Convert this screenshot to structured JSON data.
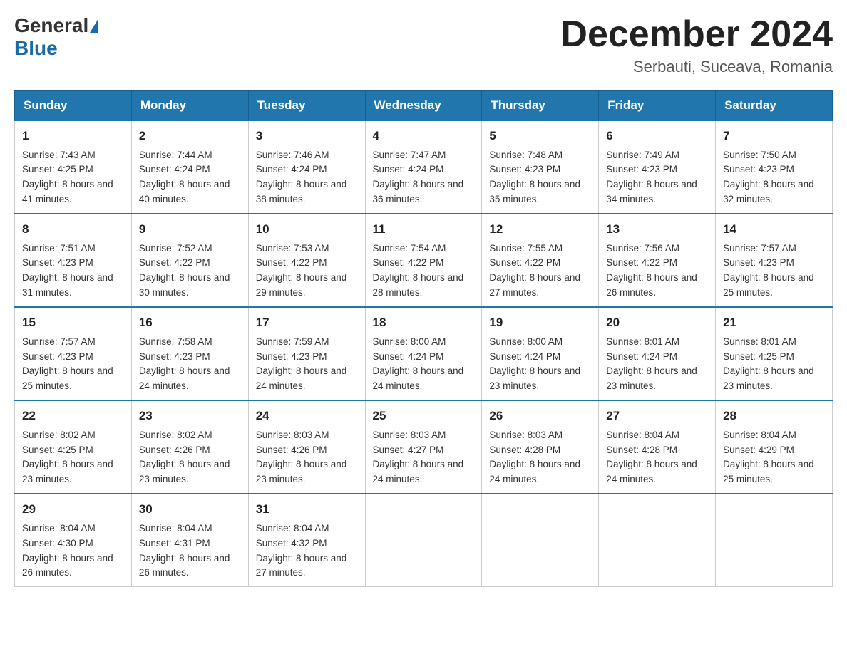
{
  "header": {
    "logo_general": "General",
    "logo_blue": "Blue",
    "month_title": "December 2024",
    "location": "Serbauti, Suceava, Romania"
  },
  "weekdays": [
    "Sunday",
    "Monday",
    "Tuesday",
    "Wednesday",
    "Thursday",
    "Friday",
    "Saturday"
  ],
  "weeks": [
    [
      {
        "day": "1",
        "sunrise": "7:43 AM",
        "sunset": "4:25 PM",
        "daylight": "8 hours and 41 minutes."
      },
      {
        "day": "2",
        "sunrise": "7:44 AM",
        "sunset": "4:24 PM",
        "daylight": "8 hours and 40 minutes."
      },
      {
        "day": "3",
        "sunrise": "7:46 AM",
        "sunset": "4:24 PM",
        "daylight": "8 hours and 38 minutes."
      },
      {
        "day": "4",
        "sunrise": "7:47 AM",
        "sunset": "4:24 PM",
        "daylight": "8 hours and 36 minutes."
      },
      {
        "day": "5",
        "sunrise": "7:48 AM",
        "sunset": "4:23 PM",
        "daylight": "8 hours and 35 minutes."
      },
      {
        "day": "6",
        "sunrise": "7:49 AM",
        "sunset": "4:23 PM",
        "daylight": "8 hours and 34 minutes."
      },
      {
        "day": "7",
        "sunrise": "7:50 AM",
        "sunset": "4:23 PM",
        "daylight": "8 hours and 32 minutes."
      }
    ],
    [
      {
        "day": "8",
        "sunrise": "7:51 AM",
        "sunset": "4:23 PM",
        "daylight": "8 hours and 31 minutes."
      },
      {
        "day": "9",
        "sunrise": "7:52 AM",
        "sunset": "4:22 PM",
        "daylight": "8 hours and 30 minutes."
      },
      {
        "day": "10",
        "sunrise": "7:53 AM",
        "sunset": "4:22 PM",
        "daylight": "8 hours and 29 minutes."
      },
      {
        "day": "11",
        "sunrise": "7:54 AM",
        "sunset": "4:22 PM",
        "daylight": "8 hours and 28 minutes."
      },
      {
        "day": "12",
        "sunrise": "7:55 AM",
        "sunset": "4:22 PM",
        "daylight": "8 hours and 27 minutes."
      },
      {
        "day": "13",
        "sunrise": "7:56 AM",
        "sunset": "4:22 PM",
        "daylight": "8 hours and 26 minutes."
      },
      {
        "day": "14",
        "sunrise": "7:57 AM",
        "sunset": "4:23 PM",
        "daylight": "8 hours and 25 minutes."
      }
    ],
    [
      {
        "day": "15",
        "sunrise": "7:57 AM",
        "sunset": "4:23 PM",
        "daylight": "8 hours and 25 minutes."
      },
      {
        "day": "16",
        "sunrise": "7:58 AM",
        "sunset": "4:23 PM",
        "daylight": "8 hours and 24 minutes."
      },
      {
        "day": "17",
        "sunrise": "7:59 AM",
        "sunset": "4:23 PM",
        "daylight": "8 hours and 24 minutes."
      },
      {
        "day": "18",
        "sunrise": "8:00 AM",
        "sunset": "4:24 PM",
        "daylight": "8 hours and 24 minutes."
      },
      {
        "day": "19",
        "sunrise": "8:00 AM",
        "sunset": "4:24 PM",
        "daylight": "8 hours and 23 minutes."
      },
      {
        "day": "20",
        "sunrise": "8:01 AM",
        "sunset": "4:24 PM",
        "daylight": "8 hours and 23 minutes."
      },
      {
        "day": "21",
        "sunrise": "8:01 AM",
        "sunset": "4:25 PM",
        "daylight": "8 hours and 23 minutes."
      }
    ],
    [
      {
        "day": "22",
        "sunrise": "8:02 AM",
        "sunset": "4:25 PM",
        "daylight": "8 hours and 23 minutes."
      },
      {
        "day": "23",
        "sunrise": "8:02 AM",
        "sunset": "4:26 PM",
        "daylight": "8 hours and 23 minutes."
      },
      {
        "day": "24",
        "sunrise": "8:03 AM",
        "sunset": "4:26 PM",
        "daylight": "8 hours and 23 minutes."
      },
      {
        "day": "25",
        "sunrise": "8:03 AM",
        "sunset": "4:27 PM",
        "daylight": "8 hours and 24 minutes."
      },
      {
        "day": "26",
        "sunrise": "8:03 AM",
        "sunset": "4:28 PM",
        "daylight": "8 hours and 24 minutes."
      },
      {
        "day": "27",
        "sunrise": "8:04 AM",
        "sunset": "4:28 PM",
        "daylight": "8 hours and 24 minutes."
      },
      {
        "day": "28",
        "sunrise": "8:04 AM",
        "sunset": "4:29 PM",
        "daylight": "8 hours and 25 minutes."
      }
    ],
    [
      {
        "day": "29",
        "sunrise": "8:04 AM",
        "sunset": "4:30 PM",
        "daylight": "8 hours and 26 minutes."
      },
      {
        "day": "30",
        "sunrise": "8:04 AM",
        "sunset": "4:31 PM",
        "daylight": "8 hours and 26 minutes."
      },
      {
        "day": "31",
        "sunrise": "8:04 AM",
        "sunset": "4:32 PM",
        "daylight": "8 hours and 27 minutes."
      },
      null,
      null,
      null,
      null
    ]
  ],
  "labels": {
    "sunrise": "Sunrise:",
    "sunset": "Sunset:",
    "daylight": "Daylight:"
  }
}
